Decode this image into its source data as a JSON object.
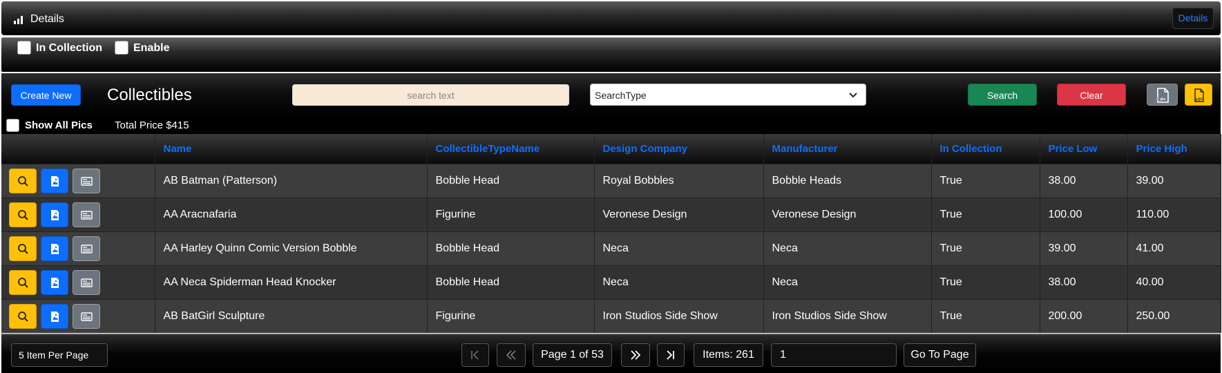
{
  "header": {
    "title": "Details",
    "details_label": "Details"
  },
  "filters": {
    "in_collection_label": "In Collection",
    "enable_label": "Enable"
  },
  "toolbar": {
    "create_new_label": "Create New",
    "heading": "Collectibles",
    "search_placeholder": "search text",
    "search_type_value": "SearchType",
    "search_label": "Search",
    "clear_label": "Clear"
  },
  "info": {
    "show_all_pics_label": "Show All Pics",
    "total_price": "Total Price $415"
  },
  "table": {
    "columns": [
      "Name",
      "CollectibleTypeName",
      "Design Company",
      "Manufacturer",
      "In Collection",
      "Price Low",
      "Price High"
    ],
    "rows": [
      [
        "AB Batman (Patterson)",
        "Bobble Head",
        "Royal Bobbles",
        "Bobble Heads",
        "True",
        "38.00",
        "39.00"
      ],
      [
        "AA Aracnafaria",
        "Figurine",
        "Veronese Design",
        "Veronese Design",
        "True",
        "100.00",
        "110.00"
      ],
      [
        "AA Harley Quinn Comic Version Bobble",
        "Bobble Head",
        "Neca",
        "Neca",
        "True",
        "39.00",
        "41.00"
      ],
      [
        "AA Neca Spiderman Head Knocker",
        "Bobble Head",
        "Neca",
        "Neca",
        "True",
        "38.00",
        "40.00"
      ],
      [
        "AB BatGirl Sculpture",
        "Figurine",
        "Iron Studios Side Show",
        "Iron Studios Side Show",
        "True",
        "200.00",
        "250.00"
      ]
    ]
  },
  "pager": {
    "per_page": "5 Item Per Page",
    "page_info": "Page 1 of 53",
    "items": "Items: 261",
    "goto_value": "1",
    "goto_label": "Go To Page"
  },
  "colors": {
    "accent": "#0d6efd",
    "success": "#198754",
    "danger": "#dc3545",
    "warning": "#ffc107",
    "secondary": "#6c757d"
  }
}
